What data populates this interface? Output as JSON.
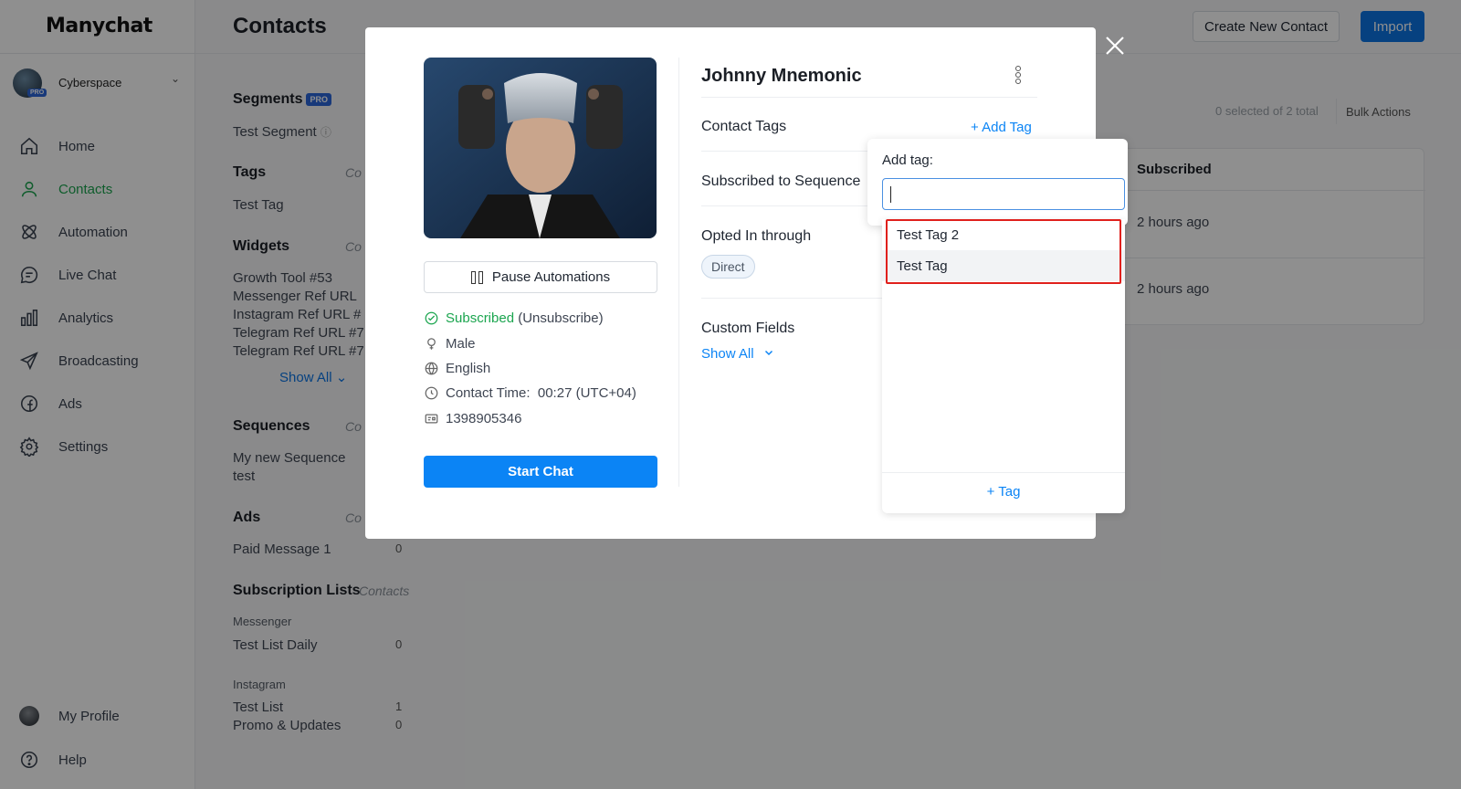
{
  "nav": {
    "logo": "Manychat",
    "account": {
      "name": "Cyberspace",
      "badge": "PRO"
    },
    "items": [
      {
        "label": "Home",
        "icon": "home-icon"
      },
      {
        "label": "Contacts",
        "icon": "person-icon",
        "active": true
      },
      {
        "label": "Automation",
        "icon": "automation-icon"
      },
      {
        "label": "Live Chat",
        "icon": "chat-bubble-icon"
      },
      {
        "label": "Analytics",
        "icon": "bar-chart-icon"
      },
      {
        "label": "Broadcasting",
        "icon": "paper-plane-icon"
      },
      {
        "label": "Ads",
        "icon": "facebook-icon"
      },
      {
        "label": "Settings",
        "icon": "gear-icon"
      }
    ],
    "profile": "My Profile",
    "help": "Help"
  },
  "header": {
    "title": "Contacts",
    "create_label": "Create New Contact",
    "import_label": "Import"
  },
  "filters": {
    "segments": {
      "heading": "Segments",
      "badge": "PRO",
      "items": [
        "Test Segment"
      ]
    },
    "tags": {
      "heading": "Tags",
      "col": "Co",
      "items": [
        "Test Tag"
      ]
    },
    "widgets": {
      "heading": "Widgets",
      "col": "Co",
      "items": [
        "Growth Tool #53",
        "Messenger Ref URL",
        "Instagram Ref URL #",
        "Telegram Ref URL #7",
        "Telegram Ref URL #7"
      ],
      "show_all": "Show All"
    },
    "sequences": {
      "heading": "Sequences",
      "col": "Co",
      "items": [
        "My new Sequence",
        "test"
      ]
    },
    "ads": {
      "heading": "Ads",
      "col": "Co",
      "items": [
        {
          "label": "Paid Message 1",
          "count": "0"
        }
      ]
    },
    "subscription_lists": {
      "heading": "Subscription Lists",
      "col": "Contacts",
      "groups": [
        {
          "name": "Messenger",
          "items": [
            {
              "label": "Test List Daily",
              "count": "0"
            }
          ]
        },
        {
          "name": "Instagram",
          "items": [
            {
              "label": "Test List",
              "count": "1"
            },
            {
              "label": "Promo & Updates",
              "count": "0"
            }
          ]
        }
      ]
    }
  },
  "table": {
    "selected_info": "0 selected of 2 total",
    "bulk_label": "Bulk Actions",
    "column": "Subscribed",
    "rows": [
      "2 hours ago",
      "2 hours ago"
    ]
  },
  "modal": {
    "contact_name": "Johnny Mnemonic",
    "pause_label": "Pause Automations",
    "status_subscribed": "Subscribed",
    "status_unsubscribe": "(Unsubscribe)",
    "gender": "Male",
    "language": "English",
    "contact_time": "Contact Time:  00:27 (UTC+04)",
    "contact_id": "1398905346",
    "start_chat_label": "Start Chat",
    "sections": {
      "tags": "Contact Tags",
      "add_tag": "+ Add Tag",
      "sequences": "Subscribed to Sequence",
      "opted_in": "Opted In through",
      "opted_chip": "Direct",
      "custom_fields": "Custom Fields",
      "show_all": "Show All"
    }
  },
  "tag_popover": {
    "label": "Add tag:",
    "input_value": "",
    "options": [
      "Test Tag 2",
      "Test Tag"
    ],
    "add_label": "+ Tag"
  },
  "colors": {
    "brand_blue": "#0b84f5",
    "active_green": "#1ba54f",
    "highlight_red": "#e0201c"
  }
}
